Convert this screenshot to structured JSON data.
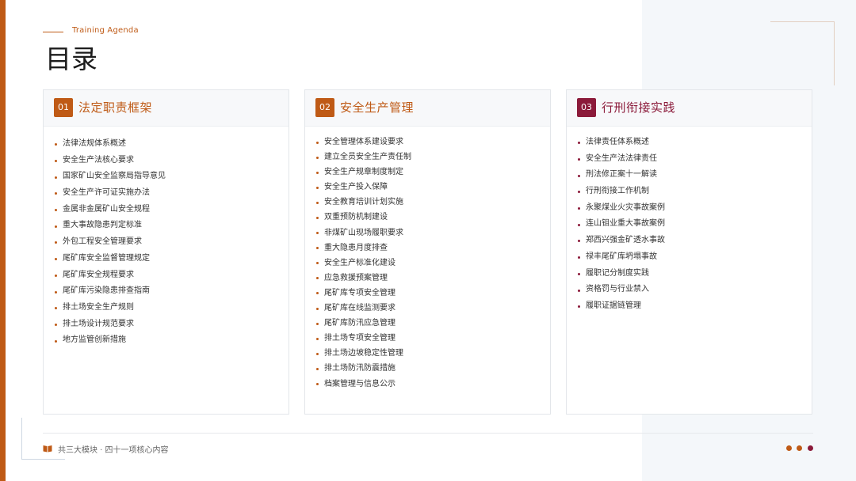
{
  "header": {
    "subtitle": "Training Agenda",
    "title": "目录"
  },
  "colors": {
    "accent": "#bf5a16",
    "accent_dark": "#8b1a3a"
  },
  "modules": [
    {
      "number": "01",
      "title": "法定职责框架",
      "items": [
        "法律法规体系概述",
        "安全生产法核心要求",
        "国家矿山安全监察局指导意见",
        "安全生产许可证实施办法",
        "金属非金属矿山安全规程",
        "重大事故隐患判定标准",
        "外包工程安全管理要求",
        "尾矿库安全监督管理规定",
        "尾矿库安全规程要求",
        "尾矿库污染隐患排查指南",
        "排土场安全生产规则",
        "排土场设计规范要求",
        "地方监管创新措施"
      ]
    },
    {
      "number": "02",
      "title": "安全生产管理",
      "items": [
        "安全管理体系建设要求",
        "建立全员安全生产责任制",
        "安全生产规章制度制定",
        "安全生产投入保障",
        "安全教育培训计划实施",
        "双重预防机制建设",
        "非煤矿山现场履职要求",
        "重大隐患月度排查",
        "安全生产标准化建设",
        "应急救援预案管理",
        "尾矿库专项安全管理",
        "尾矿库在线监测要求",
        "尾矿库防汛应急管理",
        "排土场专项安全管理",
        "排土场边坡稳定性管理",
        "排土场防汛防震措施",
        "档案管理与信息公示"
      ]
    },
    {
      "number": "03",
      "title": "行刑衔接实践",
      "items": [
        "法律责任体系概述",
        "安全生产法法律责任",
        "刑法修正案十一解读",
        "行刑衔接工作机制",
        "永聚煤业火灾事故案例",
        "连山钼业重大事故案例",
        "郑西兴强金矿透水事故",
        "禄丰尾矿库坍塌事故",
        "履职记分制度实践",
        "资格罚与行业禁入",
        "履职证据链管理"
      ]
    }
  ],
  "footer": {
    "text": "共三大模块 · 四十一项核心内容",
    "icon": "book-icon"
  }
}
